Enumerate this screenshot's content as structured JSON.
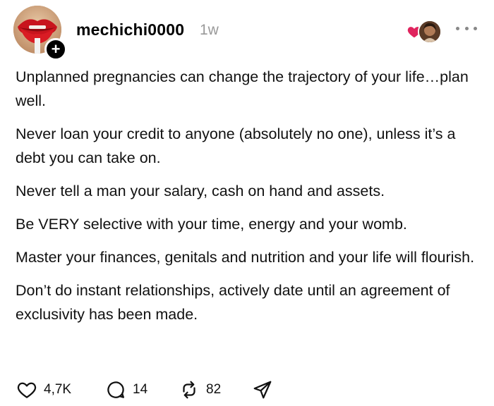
{
  "post": {
    "username": "mechichi0000",
    "timestamp": "1w",
    "follow_symbol": "+",
    "paragraphs": [
      "Unplanned pregnancies can change the trajectory of your life…plan well.",
      "Never loan your credit to anyone (absolutely no one), unless it’s a debt you can take on.",
      "Never tell a man your salary, cash on hand and assets.",
      "Be VERY selective with your time, energy and your womb.",
      "Master your finances, genitals and nutrition and your life will flourish.",
      "Don’t do instant relationships, actively date until an agreement of exclusivity has been made."
    ],
    "actions": {
      "likes": "4,7K",
      "replies": "14",
      "reposts": "82"
    }
  },
  "icons": {
    "like": "heart-icon",
    "reply": "comment-icon",
    "repost": "repost-icon",
    "share": "send-icon",
    "more": "more-horizontal-icon",
    "liked": "heart-filled-icon"
  },
  "colors": {
    "liked_heart": "#e0245e",
    "timestamp": "#999999",
    "follow_badge": "#000000"
  }
}
